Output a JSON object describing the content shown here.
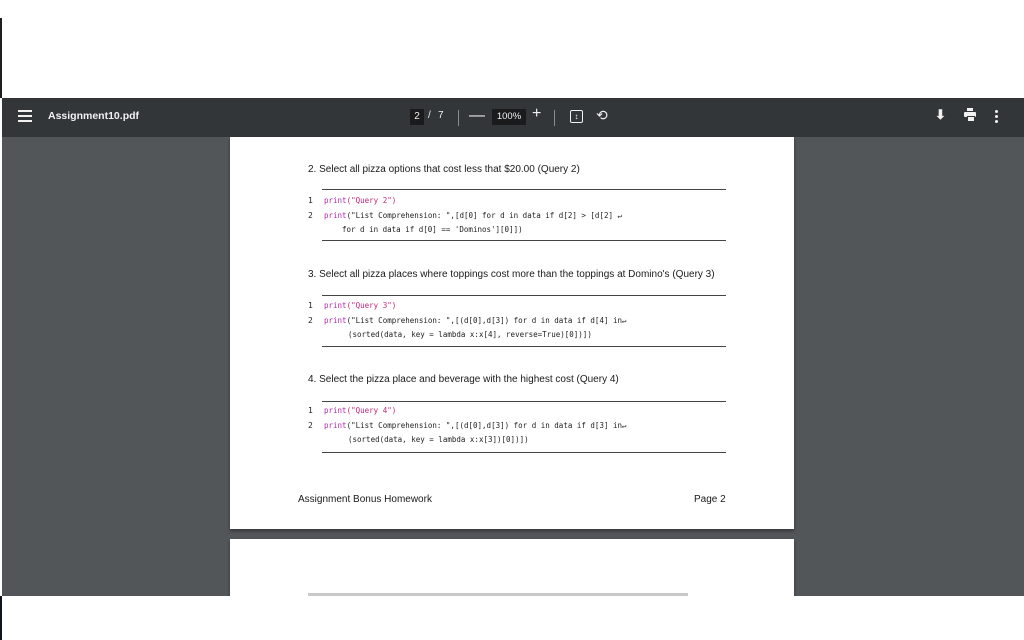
{
  "toolbar": {
    "filename": "Assignment10.pdf",
    "current_page": "2",
    "page_separator": "/",
    "total_pages": "7",
    "zoom_out": "—",
    "zoom_level": "100%",
    "zoom_in": "+",
    "icons": [
      "menu-icon",
      "fit-page-icon",
      "rotate-icon",
      "download-icon",
      "print-icon",
      "more-options-icon"
    ]
  },
  "document": {
    "q2": {
      "heading": "2.  Select all pizza options that cost less that $20.00 (Query 2)",
      "line_numbers": [
        "1",
        "2"
      ],
      "line1_fn": "print",
      "line1_arg": "(\"Query 2\")",
      "line2_fn": "print",
      "line2_rest": "(\"List Comprehension: \",[d[0] for d in data if d[2] > [d[2] ↵",
      "line3": "for d in data if d[0] == 'Dominos'][0]])"
    },
    "q3": {
      "heading": "3.  Select all pizza places where toppings cost more than the toppings at Domino's (Query 3)",
      "line_numbers": [
        "1",
        "2"
      ],
      "line1_fn": "print",
      "line1_arg": "(\"Query 3\")",
      "line2_fn": "print",
      "line2_rest": "(\"List Comprehension: \",[(d[0],d[3]) for d in data if d[4] in↵",
      "line3": "(sorted(data, key = lambda x:x[4], reverse=True)[0])])"
    },
    "q4": {
      "heading": "4.  Select the pizza place and beverage with the highest cost (Query 4)",
      "line_numbers": [
        "1",
        "2"
      ],
      "line1_fn": "print",
      "line1_arg": "(\"Query 4\")",
      "line2_fn": "print",
      "line2_rest": "(\"List Comprehension: \",[(d[0],d[3]) for d in data if d[3] in↵",
      "line3": "(sorted(data, key = lambda x:x[3])[0])])"
    },
    "footer_left": "Assignment Bonus Homework",
    "footer_right": "Page 2"
  }
}
